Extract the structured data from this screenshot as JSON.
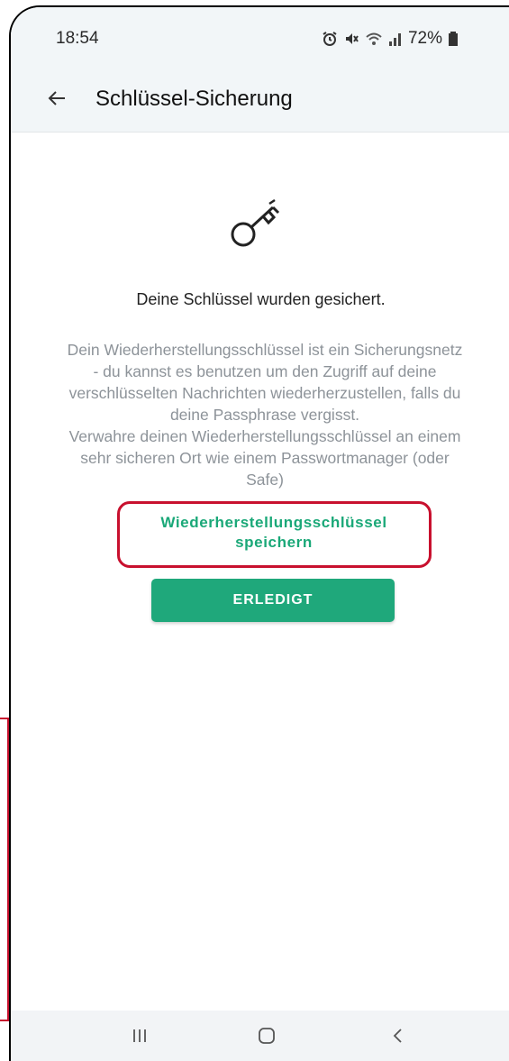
{
  "status": {
    "time": "18:54",
    "battery": "72%",
    "icons": [
      "alarm-icon",
      "mute-icon",
      "wifi-icon",
      "signal-icon",
      "battery-icon"
    ]
  },
  "header": {
    "title": "Schlüssel-Sicherung",
    "back_icon": "arrow-left-icon"
  },
  "main": {
    "icon": "key-icon",
    "headline": "Deine Schlüssel wurden gesichert.",
    "description_lines": [
      "Dein Wiederherstellungsschlüssel ist ein Sicherungsnetz",
      "- du kannst es benutzen um den Zugriff auf deine",
      "verschlüsselten Nachrichten wiederherzustellen, falls du",
      "deine Passphrase vergisst.",
      "Verwahre deinen Wiederherstellungsschlüssel an einem",
      "sehr sicheren Ort wie einem Passwortmanager (oder",
      "Safe)"
    ],
    "save_link_line1": "Wiederherstellungsschlüssel",
    "save_link_line2": "speichern",
    "done_label": "ERLEDIGT"
  },
  "navbar": {
    "items": [
      "recents-icon",
      "home-icon",
      "back-icon"
    ]
  },
  "colors": {
    "accent": "#1fa87b",
    "highlight": "#c8102e",
    "muted_text": "#8d9399"
  }
}
